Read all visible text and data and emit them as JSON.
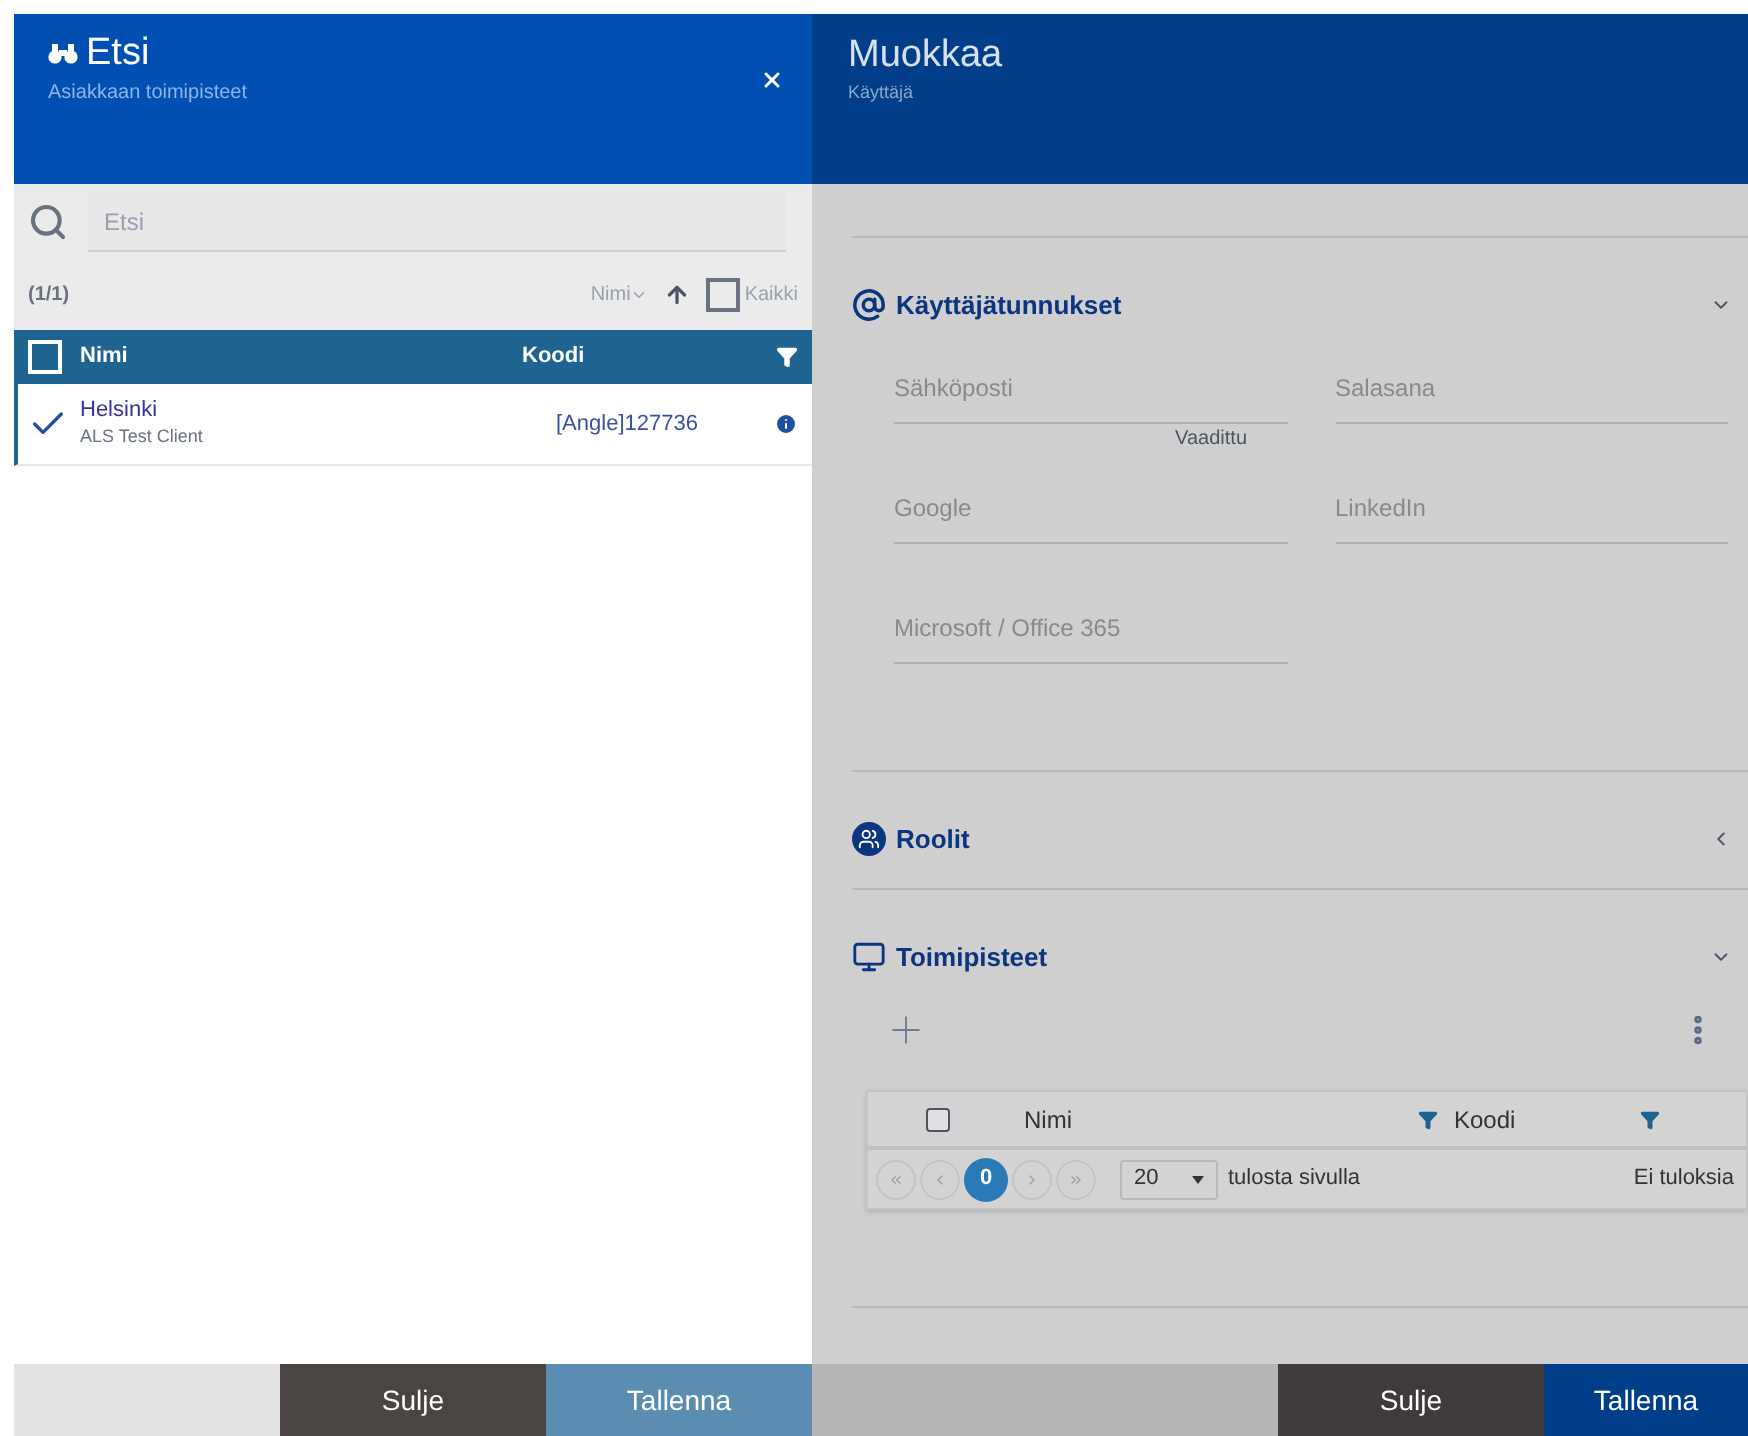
{
  "left_panel": {
    "title": "Etsi",
    "subtitle": "Asiakkaan toimipisteet",
    "search": {
      "placeholder": "Etsi"
    },
    "count": "(1/1)",
    "sort": {
      "field": "Nimi",
      "all_label": "Kaikki",
      "all_checked": false
    },
    "table": {
      "columns": [
        "Nimi",
        "Koodi"
      ],
      "header_checked": false,
      "rows": [
        {
          "name": "Helsinki",
          "client": "ALS Test Client",
          "code": "[Angle]127736",
          "selected": true
        }
      ]
    },
    "buttons": [
      {
        "label": "Sulje",
        "kind": "close"
      },
      {
        "label": "Tallenna",
        "kind": "save"
      }
    ]
  },
  "right_panel": {
    "title": "Muokkaa",
    "subtitle": "Käyttäjä",
    "sections": [
      {
        "kind": "fields",
        "title": "Käyttäjätunnukset",
        "expanded": true,
        "fields": [
          {
            "placeholder": "Sähköposti",
            "hint": "Vaadittu"
          },
          {
            "placeholder": "Salasana"
          },
          {
            "placeholder": "Google"
          },
          {
            "placeholder": "LinkedIn"
          },
          {
            "placeholder": "Microsoft / Office 365"
          }
        ]
      },
      {
        "kind": "roles",
        "title": "Roolit",
        "expanded": false
      },
      {
        "kind": "table",
        "title": "Toimipisteet",
        "expanded": true,
        "table": {
          "columns": [
            "Nimi",
            "Koodi"
          ],
          "header_checked": false,
          "page": "0",
          "page_size": "20",
          "page_size_label": "tulosta sivulla",
          "status": "Ei tuloksia"
        }
      }
    ],
    "buttons": [
      {
        "label": "Sulje",
        "kind": "close"
      },
      {
        "label": "Tallenna",
        "kind": "save"
      }
    ]
  }
}
